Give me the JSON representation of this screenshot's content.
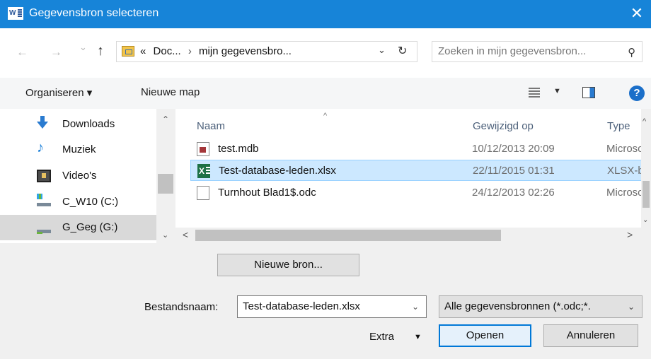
{
  "titlebar": {
    "title": "Gegevensbron selecteren",
    "close_glyph": "✕",
    "app_icon_glyph": "W"
  },
  "nav": {
    "back_glyph": "←",
    "forward_glyph": "→",
    "recent_glyph": "⌄",
    "up_glyph": "↑"
  },
  "address": {
    "overflow": "«",
    "crumb1": "Doc...",
    "separator": "›",
    "crumb2": "mijn gegevensbro...",
    "dropdown_glyph": "⌄",
    "refresh_glyph": "↻"
  },
  "search": {
    "placeholder": "Zoeken in mijn gegevensbron...",
    "icon_glyph": "⚲"
  },
  "toolbar": {
    "organize_label": "Organiseren ▾",
    "new_folder_label": "Nieuwe map",
    "view_dropdown": "▼",
    "help_label": "?"
  },
  "tree": {
    "items": [
      {
        "label": "Downloads",
        "icon": "download-icon"
      },
      {
        "label": "Muziek",
        "icon": "music-icon",
        "glyph": "♪"
      },
      {
        "label": "Video's",
        "icon": "video-icon"
      },
      {
        "label": "C_W10 (C:)",
        "icon": "drive-icon"
      },
      {
        "label": "G_Geg (G:)",
        "icon": "network-drive-icon",
        "selected": true
      }
    ],
    "scroll_up": "⌃",
    "scroll_down": "⌄"
  },
  "files": {
    "sort_indicator": "^",
    "columns": {
      "name": "Naam",
      "modified": "Gewijzigd op",
      "type": "Type"
    },
    "rows": [
      {
        "name": "test.mdb",
        "modified": "10/12/2013 20:09",
        "type": "Microsoft",
        "icon": "access-file-icon"
      },
      {
        "name": "Test-database-leden.xlsx",
        "modified": "22/11/2015 01:31",
        "type": "XLSX-bestand",
        "icon": "excel-file-icon",
        "icon_text": "X",
        "selected": true
      },
      {
        "name": "Turnhout Blad1$.odc",
        "modified": "24/12/2013 02:26",
        "type": "Microsoft",
        "icon": "document-file-icon"
      }
    ],
    "vscroll_up": "^",
    "vscroll_down": "⌄",
    "hscroll_left": "<",
    "hscroll_right": ">"
  },
  "bottom": {
    "new_source_label": "Nieuwe bron...",
    "filename_label": "Bestandsnaam:",
    "filename_value": "Test-database-leden.xlsx",
    "filename_chevron": "⌄",
    "filter_value": "Alle gegevensbronnen (*.odc;*.",
    "filter_chevron": "⌄",
    "extra_label": "Extra",
    "extra_arrow": "▼",
    "open_label": "Openen",
    "cancel_label": "Annuleren"
  },
  "colors": {
    "titlebar": "#1784d8",
    "selection": "#cce8ff",
    "selection_border": "#99d1ff",
    "default_button_border": "#0078d7"
  }
}
